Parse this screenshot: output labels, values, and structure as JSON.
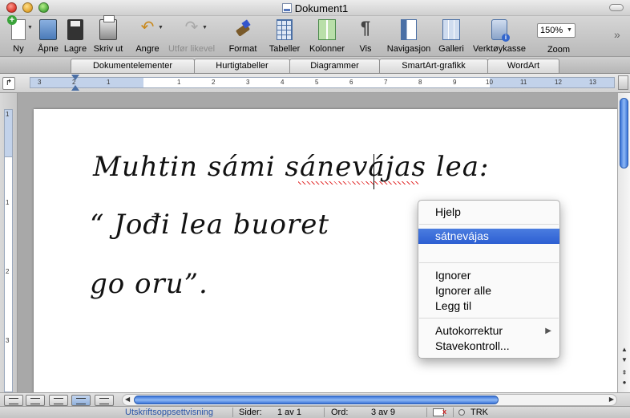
{
  "window": {
    "title": "Dokument1"
  },
  "toolbar": {
    "new": "Ny",
    "open": "Åpne",
    "save": "Lagre",
    "print": "Skriv ut",
    "undo": "Angre",
    "redo": "Utfør likevel",
    "format": "Format",
    "tables": "Tabeller",
    "columns": "Kolonner",
    "show": "Vis",
    "navigation": "Navigasjon",
    "gallery": "Galleri",
    "toolbox": "Verktøykasse",
    "zoom_label": "Zoom",
    "zoom_value": "150%"
  },
  "ribbon": {
    "tabs": [
      "Dokumentelementer",
      "Hurtigtabeller",
      "Diagrammer",
      "SmartArt-grafikk",
      "WordArt"
    ]
  },
  "ruler": {
    "numbers": [
      "3",
      "2",
      "1",
      "1",
      "2",
      "3",
      "4",
      "5",
      "6",
      "7",
      "8",
      "9",
      "10",
      "11",
      "12",
      "13"
    ]
  },
  "vruler": {
    "numbers": [
      "1",
      "1",
      "2",
      "3"
    ]
  },
  "document": {
    "line1": "Muhtin sámi sánevájas lea:",
    "line2": "“ Jođi lea buoret",
    "line3": "go oru”."
  },
  "context_menu": {
    "help": "Hjelp",
    "suggestion": "sátnevájas",
    "ignore": "Ignorer",
    "ignore_all": "Ignorer alle",
    "add": "Legg til",
    "autocorrect": "Autokorrektur",
    "spelling": "Stavekontroll..."
  },
  "statusbar": {
    "view": "Utskriftsoppsettvisning",
    "pages_label": "Sider:",
    "pages_value": "1 av 1",
    "words_label": "Ord:",
    "words_value": "3 av 9",
    "trk": "TRK"
  },
  "colors": {
    "accent": "#2d5fd2",
    "scroll": "#3a74d8",
    "spell_error": "#e02020"
  },
  "icons": [
    "new-document-icon",
    "open-icon",
    "save-icon",
    "print-icon",
    "undo-icon",
    "redo-icon",
    "format-brush-icon",
    "table-icon",
    "columns-icon",
    "pilcrow-icon",
    "navigation-icon",
    "gallery-icon",
    "toolbox-icon"
  ]
}
